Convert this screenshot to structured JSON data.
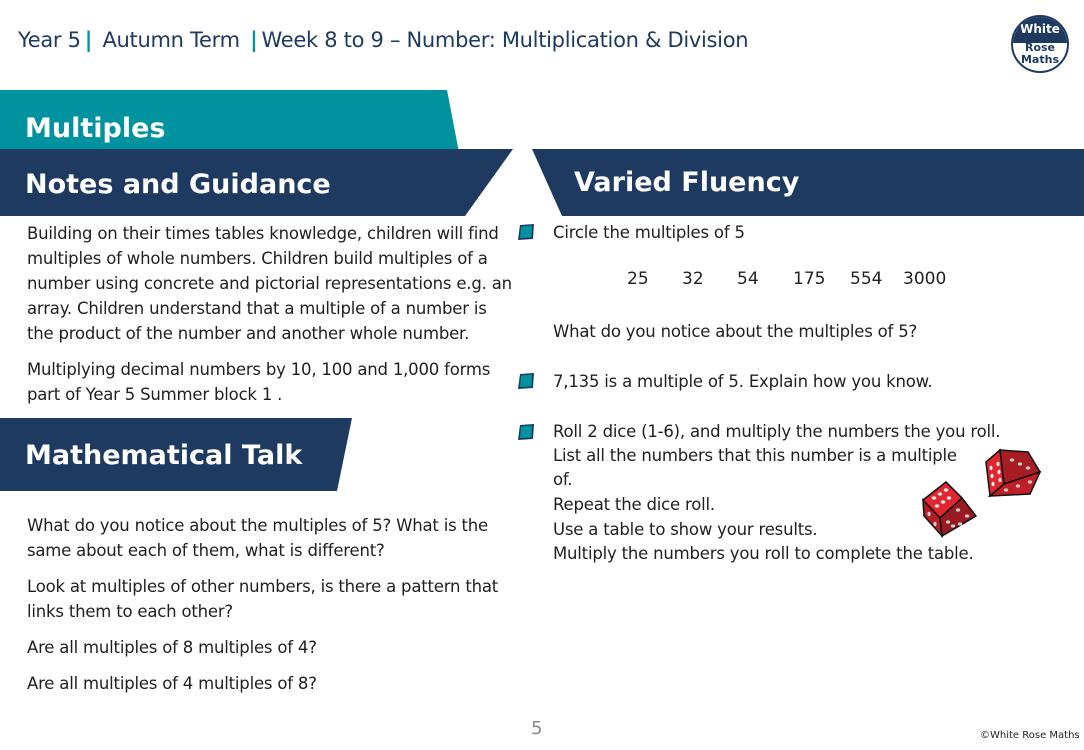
{
  "header": {
    "year": "Year 5",
    "term": "Autumn Term",
    "week": "Week 8 to 9 – Number: Multiplication & Division",
    "separator": "|"
  },
  "logo": {
    "line1": "White",
    "line2": "Rose",
    "line3": "Maths"
  },
  "banners": {
    "topic": "Multiples",
    "notes": "Notes and Guidance",
    "fluency": "Varied Fluency",
    "talk": "Mathematical Talk"
  },
  "notes": {
    "paragraphs": [
      "Building on their times tables knowledge, children will find multiples of whole numbers. Children build multiples of a number using concrete and pictorial representations e.g. an array.  Children understand that a multiple of a number is the product of the number and another whole number.",
      "Multiplying decimal numbers by 10, 100 and 1,000 forms part of Year 5 Summer block 1 ."
    ]
  },
  "talk": {
    "questions": [
      "What do you notice about the multiples of 5? What is the same about each of them, what is different?",
      "Look at multiples of other numbers, is there a pattern that links them to each other?",
      "Are all multiples of 8 multiples of 4?",
      "Are all multiples of 4 multiples of 8?"
    ]
  },
  "fluency": {
    "q1": {
      "prompt": "Circle the multiples of 5",
      "numbers": [
        "25",
        "32",
        "54",
        "175",
        "554",
        "3000"
      ],
      "followup": "What do you notice about the multiples of 5?"
    },
    "q2": {
      "prompt": "7,135 is a multiple of 5.  Explain how you know."
    },
    "q3": {
      "lines": [
        "Roll 2 dice (1-6), and multiply the numbers the you roll.",
        "List all the numbers that this number is a multiple",
        "of.",
        "Repeat the dice roll.",
        "Use a table to show your results.",
        "Multiply the numbers you roll to complete the table."
      ]
    }
  },
  "footer": {
    "page_number": "5",
    "copyright": "©White Rose Maths"
  },
  "colors": {
    "navy": "#1f3a60",
    "teal": "#00939f",
    "dice_red": "#c8202a"
  }
}
